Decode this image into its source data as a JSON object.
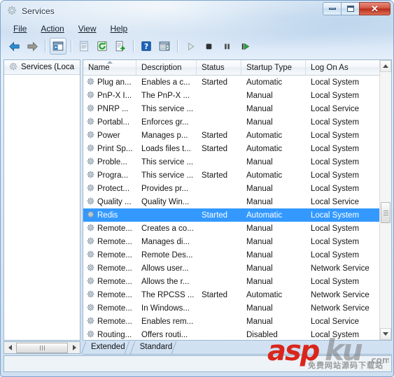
{
  "window": {
    "title": "Services",
    "title_icon": "services-gear-icon",
    "buttons": {
      "minimize": "Minimize",
      "maximize": "Maximize",
      "close": "Close"
    }
  },
  "menubar": {
    "items": [
      {
        "label": "File",
        "accel": "F"
      },
      {
        "label": "Action",
        "accel": "A"
      },
      {
        "label": "View",
        "accel": "V"
      },
      {
        "label": "Help",
        "accel": "H"
      }
    ]
  },
  "toolbar": {
    "buttons": [
      {
        "name": "back-icon",
        "label": "Back",
        "state": "enabled"
      },
      {
        "name": "forward-icon",
        "label": "Forward",
        "state": "enabled"
      },
      {
        "name": "show-hide-tree-icon",
        "label": "Show/Hide Console Tree",
        "state": "pressed"
      },
      {
        "name": "properties-icon",
        "label": "Properties",
        "state": "disabled"
      },
      {
        "name": "refresh-icon",
        "label": "Refresh",
        "state": "enabled"
      },
      {
        "name": "export-list-icon",
        "label": "Export List",
        "state": "enabled"
      },
      {
        "name": "help-icon",
        "label": "Help",
        "state": "enabled"
      },
      {
        "name": "show-action-pane-icon",
        "label": "Show/Hide Action Pane",
        "state": "enabled"
      },
      {
        "name": "start-service-icon",
        "label": "Start Service",
        "state": "disabled"
      },
      {
        "name": "stop-service-icon",
        "label": "Stop Service",
        "state": "enabled"
      },
      {
        "name": "pause-service-icon",
        "label": "Pause Service",
        "state": "enabled"
      },
      {
        "name": "restart-service-icon",
        "label": "Restart Service",
        "state": "enabled"
      }
    ]
  },
  "tree": {
    "root_label": "Services (Loca",
    "root_icon": "services-gear-icon"
  },
  "list": {
    "columns": [
      {
        "key": "name",
        "label": "Name",
        "sorted": true
      },
      {
        "key": "desc",
        "label": "Description",
        "sorted": false
      },
      {
        "key": "status",
        "label": "Status",
        "sorted": false
      },
      {
        "key": "startup",
        "label": "Startup Type",
        "sorted": false
      },
      {
        "key": "logon",
        "label": "Log On As",
        "sorted": false
      }
    ],
    "rows": [
      {
        "name": "Plug an...",
        "desc": "Enables a c...",
        "status": "Started",
        "startup": "Automatic",
        "logon": "Local System",
        "selected": false
      },
      {
        "name": "PnP-X I...",
        "desc": "The PnP-X ...",
        "status": "",
        "startup": "Manual",
        "logon": "Local System",
        "selected": false
      },
      {
        "name": "PNRP ...",
        "desc": "This service ...",
        "status": "",
        "startup": "Manual",
        "logon": "Local Service",
        "selected": false
      },
      {
        "name": "Portabl...",
        "desc": "Enforces gr...",
        "status": "",
        "startup": "Manual",
        "logon": "Local System",
        "selected": false
      },
      {
        "name": "Power",
        "desc": "Manages p...",
        "status": "Started",
        "startup": "Automatic",
        "logon": "Local System",
        "selected": false
      },
      {
        "name": "Print Sp...",
        "desc": "Loads files t...",
        "status": "Started",
        "startup": "Automatic",
        "logon": "Local System",
        "selected": false
      },
      {
        "name": "Proble...",
        "desc": "This service ...",
        "status": "",
        "startup": "Manual",
        "logon": "Local System",
        "selected": false
      },
      {
        "name": "Progra...",
        "desc": "This service ...",
        "status": "Started",
        "startup": "Automatic",
        "logon": "Local System",
        "selected": false
      },
      {
        "name": "Protect...",
        "desc": "Provides pr...",
        "status": "",
        "startup": "Manual",
        "logon": "Local System",
        "selected": false
      },
      {
        "name": "Quality ...",
        "desc": "Quality Win...",
        "status": "",
        "startup": "Manual",
        "logon": "Local Service",
        "selected": false
      },
      {
        "name": "Redis",
        "desc": "",
        "status": "Started",
        "startup": "Automatic",
        "logon": "Local System",
        "selected": true
      },
      {
        "name": "Remote...",
        "desc": "Creates a co...",
        "status": "",
        "startup": "Manual",
        "logon": "Local System",
        "selected": false
      },
      {
        "name": "Remote...",
        "desc": "Manages di...",
        "status": "",
        "startup": "Manual",
        "logon": "Local System",
        "selected": false
      },
      {
        "name": "Remote...",
        "desc": "Remote Des...",
        "status": "",
        "startup": "Manual",
        "logon": "Local System",
        "selected": false
      },
      {
        "name": "Remote...",
        "desc": "Allows user...",
        "status": "",
        "startup": "Manual",
        "logon": "Network Service",
        "selected": false
      },
      {
        "name": "Remote...",
        "desc": "Allows the r...",
        "status": "",
        "startup": "Manual",
        "logon": "Local System",
        "selected": false
      },
      {
        "name": "Remote...",
        "desc": "The RPCSS ...",
        "status": "Started",
        "startup": "Automatic",
        "logon": "Network Service",
        "selected": false
      },
      {
        "name": "Remote...",
        "desc": "In Windows...",
        "status": "",
        "startup": "Manual",
        "logon": "Network Service",
        "selected": false
      },
      {
        "name": "Remote...",
        "desc": "Enables rem...",
        "status": "",
        "startup": "Manual",
        "logon": "Local Service",
        "selected": false
      },
      {
        "name": "Routing...",
        "desc": "Offers routi...",
        "status": "",
        "startup": "Disabled",
        "logon": "Local System",
        "selected": false
      }
    ],
    "row_icon": "service-gear-icon",
    "selection_color": "#3399ff"
  },
  "scrollbars": {
    "vertical": {
      "up_icon": "triangle-up-icon",
      "down_icon": "triangle-down-icon"
    },
    "horizontal": {
      "left_icon": "triangle-left-icon",
      "right_icon": "triangle-right-icon"
    }
  },
  "tabs": {
    "items": [
      {
        "label": "Extended",
        "active": true
      },
      {
        "label": "Standard",
        "active": false
      }
    ]
  },
  "statusbar": {
    "text": ""
  },
  "watermark": {
    "asp": "asp",
    "ku": "ku",
    "com": ".com",
    "subtitle": "免费网站源码下载站",
    "brand_color": "#d9261c"
  }
}
